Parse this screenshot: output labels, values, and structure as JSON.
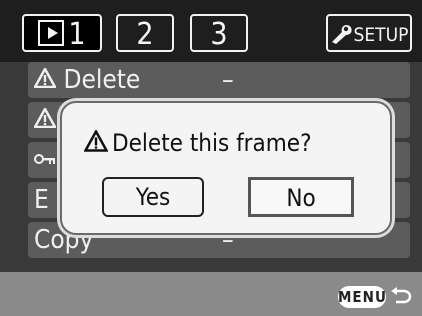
{
  "tabs": [
    {
      "label": "1",
      "icon": "playback-icon",
      "active": true
    },
    {
      "label": "2"
    },
    {
      "label": "3"
    },
    {
      "label": "SETUP",
      "icon": "wrench-icon"
    }
  ],
  "menu": {
    "rows": [
      {
        "label": "Delete",
        "value": "–",
        "icon": "warning-icon"
      },
      {
        "label": "",
        "value": "",
        "icon": "warning-icon"
      },
      {
        "label": "",
        "value": "",
        "icon": "key-icon"
      },
      {
        "label": "E",
        "value": ""
      },
      {
        "label": "Copy",
        "value": "–"
      }
    ]
  },
  "dialog": {
    "title": "Delete this frame?",
    "yes_label": "Yes",
    "no_label": "No",
    "selected": "No"
  },
  "footer": {
    "menu_label": "MENU",
    "back_icon": "return-icon"
  },
  "colors": {
    "background": "#3a3a3a",
    "row": "#5c5c5c",
    "dialog": "#f4f4f4",
    "bottom_bar": "#8a8a8a"
  }
}
